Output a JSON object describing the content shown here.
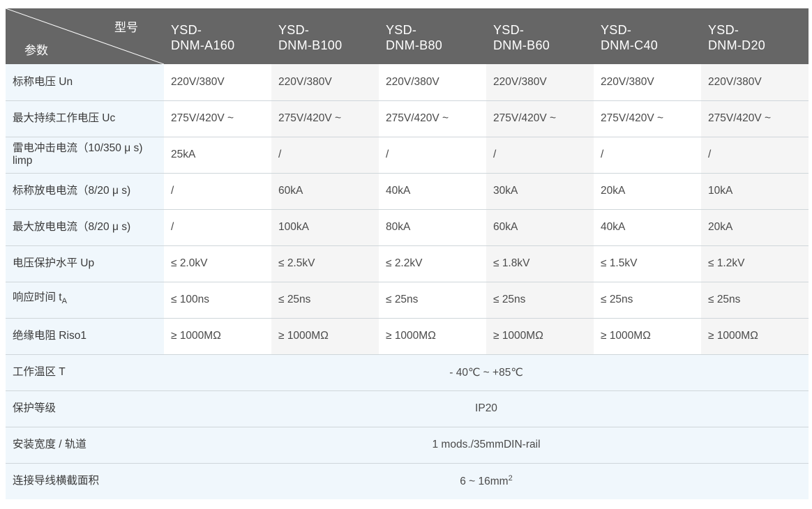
{
  "header": {
    "corner_top": "型号",
    "corner_bottom": "参数",
    "models": [
      {
        "line1": "YSD-",
        "line2": "DNM-A160"
      },
      {
        "line1": "YSD-",
        "line2": "DNM-B100"
      },
      {
        "line1": "YSD-",
        "line2": "DNM-B80"
      },
      {
        "line1": "YSD-",
        "line2": "DNM-B60"
      },
      {
        "line1": "YSD-",
        "line2": "DNM-C40"
      },
      {
        "line1": "YSD-",
        "line2": "DNM-D20"
      }
    ]
  },
  "rows": [
    {
      "param": "标称电压 Un",
      "values": [
        "220V/380V",
        "220V/380V",
        "220V/380V",
        "220V/380V",
        "220V/380V",
        "220V/380V"
      ]
    },
    {
      "param": "最大持续工作电压 Uc",
      "values": [
        "275V/420V ~",
        "275V/420V ~",
        "275V/420V ~",
        "275V/420V ~",
        "275V/420V ~",
        "275V/420V ~"
      ]
    },
    {
      "param_line1": "雷电冲击电流（10/350 μ s)",
      "param_line2": "limp",
      "values": [
        "25kA",
        "/",
        "/",
        "/",
        "/",
        "/"
      ]
    },
    {
      "param": "标称放电电流（8/20 μ s)",
      "values": [
        "/",
        "60kA",
        "40kA",
        "30kA",
        "20kA",
        "10kA"
      ]
    },
    {
      "param": "最大放电电流（8/20 μ s)",
      "values": [
        "/",
        "100kA",
        "80kA",
        "60kA",
        "40kA",
        "20kA"
      ]
    },
    {
      "param": "电压保护水平 Up",
      "values": [
        "≤ 2.0kV",
        "≤ 2.5kV",
        "≤ 2.2kV",
        "≤ 1.8kV",
        "≤ 1.5kV",
        "≤ 1.2kV"
      ]
    },
    {
      "param_main": "响应时间 t",
      "param_sub": "A",
      "values": [
        "≤ 100ns",
        "≤ 25ns",
        "≤ 25ns",
        "≤ 25ns",
        "≤ 25ns",
        "≤ 25ns"
      ]
    },
    {
      "param": "绝缘电阻 Riso1",
      "values": [
        "≥ 1000MΩ",
        "≥ 1000MΩ",
        "≥ 1000MΩ",
        "≥ 1000MΩ",
        "≥ 1000MΩ",
        "≥ 1000MΩ"
      ]
    }
  ],
  "span_rows": [
    {
      "param": "工作温区 T",
      "value": "- 40℃ ~ +85℃"
    },
    {
      "param": "保护等级",
      "value": "IP20"
    },
    {
      "param": "安装宽度 / 轨道",
      "value": "1 mods./35mmDIN-rail"
    },
    {
      "param": "连接导线横截面积",
      "value_main": "6 ~ 16mm",
      "value_sup": "2"
    }
  ]
}
